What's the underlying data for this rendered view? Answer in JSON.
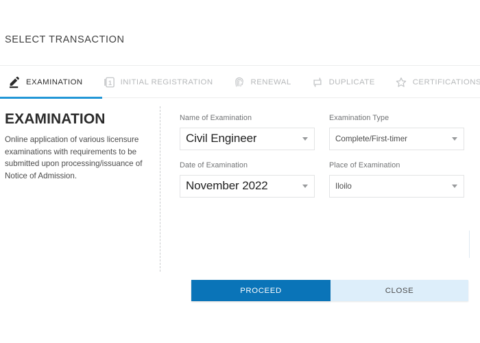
{
  "header": {
    "title": "SELECT TRANSACTION"
  },
  "tabs": [
    {
      "label": "EXAMINATION",
      "icon": "pencil-icon",
      "active": true
    },
    {
      "label": "INITIAL REGISTRATION",
      "icon": "number-one-icon",
      "active": false
    },
    {
      "label": "RENEWAL",
      "icon": "fingerprint-icon",
      "active": false
    },
    {
      "label": "DUPLICATE",
      "icon": "duplicate-icon",
      "active": false
    },
    {
      "label": "CERTIFICATIONS",
      "icon": "star-icon",
      "active": false
    }
  ],
  "left_panel": {
    "title": "EXAMINATION",
    "description": "Online application of various licensure examinations with requirements to be submitted upon processing/issuance of Notice of Admission."
  },
  "form": {
    "fields": [
      {
        "label": "Name of Examination",
        "value": "Civil Engineer",
        "size": "big"
      },
      {
        "label": "Examination Type",
        "value": "Complete/First-timer",
        "size": "small"
      },
      {
        "label": "Date of Examination",
        "value": "November 2022",
        "size": "big"
      },
      {
        "label": "Place of Examination",
        "value": "Iloilo",
        "size": "small"
      }
    ]
  },
  "footer": {
    "proceed_label": "PROCEED",
    "close_label": "CLOSE"
  },
  "colors": {
    "accent_blue": "#0a74b8",
    "tab_underline": "#2196d6",
    "close_button": "#ddeefa",
    "muted_text": "#b6b8ba"
  }
}
